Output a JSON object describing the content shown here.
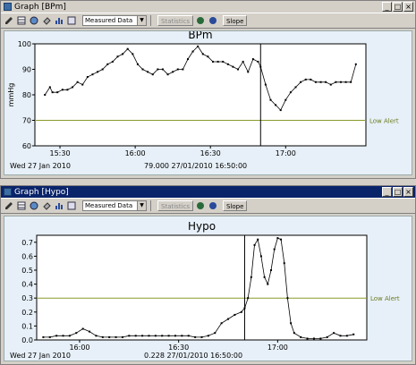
{
  "window1": {
    "title": "Graph [BPm]",
    "toolbar": {
      "select_value": "Measured Data",
      "statistics_label": "Statistics",
      "slope_label": "Slope"
    },
    "chart": {
      "title": "BPm",
      "ylabel": "mmHg",
      "yticks": [
        "60",
        "70",
        "80",
        "90",
        "100"
      ],
      "xticks": [
        "15:30",
        "16:00",
        "16:30",
        "17:00"
      ],
      "alert_label": "Low Alert",
      "date_label": "Wed 27 Jan 2010",
      "cursor_readout": "79.000  27/01/2010 16:50:00"
    }
  },
  "window2": {
    "title": "Graph [Hypo]",
    "toolbar": {
      "select_value": "Measured Data",
      "statistics_label": "Statistics",
      "slope_label": "Slope"
    },
    "chart": {
      "title": "Hypo",
      "yticks": [
        "0.0",
        "0.1",
        "0.2",
        "0.3",
        "0.4",
        "0.5",
        "0.6",
        "0.7"
      ],
      "xticks": [
        "16:00",
        "16:30",
        "17:00"
      ],
      "alert_label": "Low Alert",
      "date_label": "Wed 27 Jan 2010",
      "cursor_readout": "0.228  27/01/2010 16:50:00"
    }
  },
  "chart_data": [
    {
      "type": "line",
      "title": "BPm",
      "ylabel": "mmHg",
      "ylim": [
        60,
        100
      ],
      "xlim": [
        "15:20",
        "17:32"
      ],
      "alert_line": 70,
      "cursor_time": "16:50",
      "line_color": "#000000",
      "alert_color": "#8a9a2a",
      "series": [
        {
          "x": [
            "15:24",
            "15:26",
            "15:27",
            "15:29",
            "15:31",
            "15:33",
            "15:35",
            "15:37",
            "15:39",
            "15:41",
            "15:43",
            "15:45",
            "15:47",
            "15:49",
            "15:51",
            "15:53",
            "15:55",
            "15:57",
            "15:59",
            "16:01",
            "16:03",
            "16:05",
            "16:07",
            "16:09",
            "16:11",
            "16:13",
            "16:15",
            "16:17",
            "16:19",
            "16:21",
            "16:23",
            "16:25",
            "16:27",
            "16:29",
            "16:31",
            "16:33",
            "16:35",
            "16:37",
            "16:39",
            "16:41",
            "16:43",
            "16:45",
            "16:47",
            "16:49",
            "16:50",
            "16:52",
            "16:54",
            "16:56",
            "16:58",
            "17:00",
            "17:02",
            "17:04",
            "17:06",
            "17:08",
            "17:10",
            "17:12",
            "17:14",
            "17:16",
            "17:18",
            "17:20",
            "17:22",
            "17:24",
            "17:26",
            "17:28"
          ],
          "y": [
            80,
            83,
            81,
            81,
            82,
            82,
            83,
            85,
            84,
            87,
            88,
            89,
            90,
            92,
            93,
            95,
            96,
            98,
            96,
            92,
            90,
            89,
            88,
            90,
            90,
            88,
            89,
            90,
            90,
            94,
            97,
            99,
            96,
            95,
            93,
            93,
            93,
            92,
            91,
            90,
            93,
            89,
            94,
            93,
            91,
            84,
            78,
            76,
            74,
            78,
            81,
            83,
            85,
            86,
            86,
            85,
            85,
            85,
            84,
            85,
            85,
            85,
            85,
            92
          ]
        }
      ]
    },
    {
      "type": "line",
      "title": "Hypo",
      "ylim": [
        0,
        0.75
      ],
      "xlim": [
        "15:47",
        "17:27"
      ],
      "alert_line": 0.3,
      "cursor_time": "16:50",
      "line_color": "#000000",
      "alert_color": "#8a9a2a",
      "series": [
        {
          "x": [
            "15:49",
            "15:51",
            "15:53",
            "15:55",
            "15:57",
            "15:59",
            "16:01",
            "16:03",
            "16:05",
            "16:07",
            "16:09",
            "16:11",
            "16:13",
            "16:15",
            "16:17",
            "16:19",
            "16:21",
            "16:23",
            "16:25",
            "16:27",
            "16:29",
            "16:31",
            "16:33",
            "16:35",
            "16:37",
            "16:39",
            "16:41",
            "16:43",
            "16:45",
            "16:47",
            "16:49",
            "16:50",
            "16:51",
            "16:52",
            "16:53",
            "16:54",
            "16:55",
            "16:56",
            "16:57",
            "16:58",
            "16:59",
            "17:00",
            "17:01",
            "17:02",
            "17:03",
            "17:04",
            "17:05",
            "17:07",
            "17:09",
            "17:11",
            "17:13",
            "17:15",
            "17:17",
            "17:19",
            "17:21",
            "17:23"
          ],
          "y": [
            0.02,
            0.02,
            0.03,
            0.03,
            0.03,
            0.05,
            0.08,
            0.06,
            0.03,
            0.02,
            0.02,
            0.02,
            0.02,
            0.03,
            0.03,
            0.03,
            0.03,
            0.03,
            0.03,
            0.03,
            0.03,
            0.03,
            0.03,
            0.02,
            0.02,
            0.03,
            0.05,
            0.12,
            0.15,
            0.18,
            0.2,
            0.228,
            0.3,
            0.45,
            0.68,
            0.72,
            0.6,
            0.45,
            0.4,
            0.5,
            0.65,
            0.73,
            0.72,
            0.55,
            0.3,
            0.12,
            0.05,
            0.02,
            0.01,
            0.01,
            0.01,
            0.02,
            0.05,
            0.03,
            0.03,
            0.04
          ]
        }
      ]
    }
  ]
}
